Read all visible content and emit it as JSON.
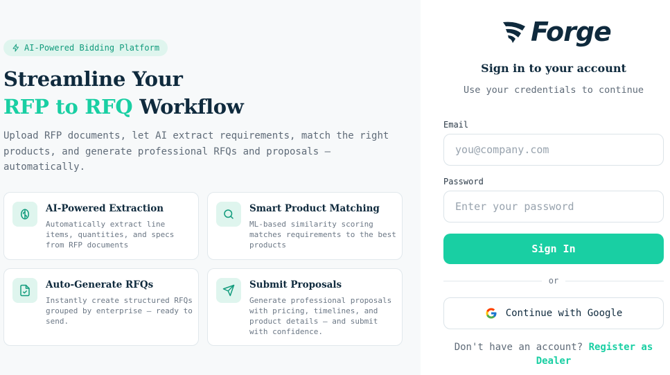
{
  "left": {
    "badge": "AI-Powered Bidding Platform",
    "hero_line1": "Streamline Your",
    "hero_accent": "RFP to RFQ",
    "hero_rest": "Workflow",
    "description": "Upload RFP documents, let AI extract requirements, match the right products, and generate professional RFQs and proposals — automatically.",
    "features": [
      {
        "title": "AI-Powered Extraction",
        "description": "Automatically extract line items, quantities, and specs from RFP documents",
        "icon": "brain-icon"
      },
      {
        "title": "Smart Product Matching",
        "description": "ML-based similarity scoring matches requirements to the best products",
        "icon": "search-icon"
      },
      {
        "title": "Auto-Generate RFQs",
        "description": "Instantly create structured RFQs grouped by enterprise — ready to send.",
        "icon": "file-check-icon"
      },
      {
        "title": "Submit Proposals",
        "description": "Generate professional proposals with pricing, timelines, and product details — and submit with confidence.",
        "icon": "send-icon"
      }
    ]
  },
  "auth": {
    "brand": "Forge",
    "title": "Sign in to your account",
    "subtitle": "Use your credentials to continue",
    "email_label": "Email",
    "email_placeholder": "you@company.com",
    "password_label": "Password",
    "password_placeholder": "Enter your password",
    "signin_label": "Sign In",
    "or_label": "or",
    "google_label": "Continue with Google",
    "register_prompt": "Don't have an account?",
    "register_link": "Register as Dealer"
  },
  "colors": {
    "accent": "#19cfa3",
    "navy": "#0f2a3d",
    "badge_bg": "#dff5ee"
  }
}
